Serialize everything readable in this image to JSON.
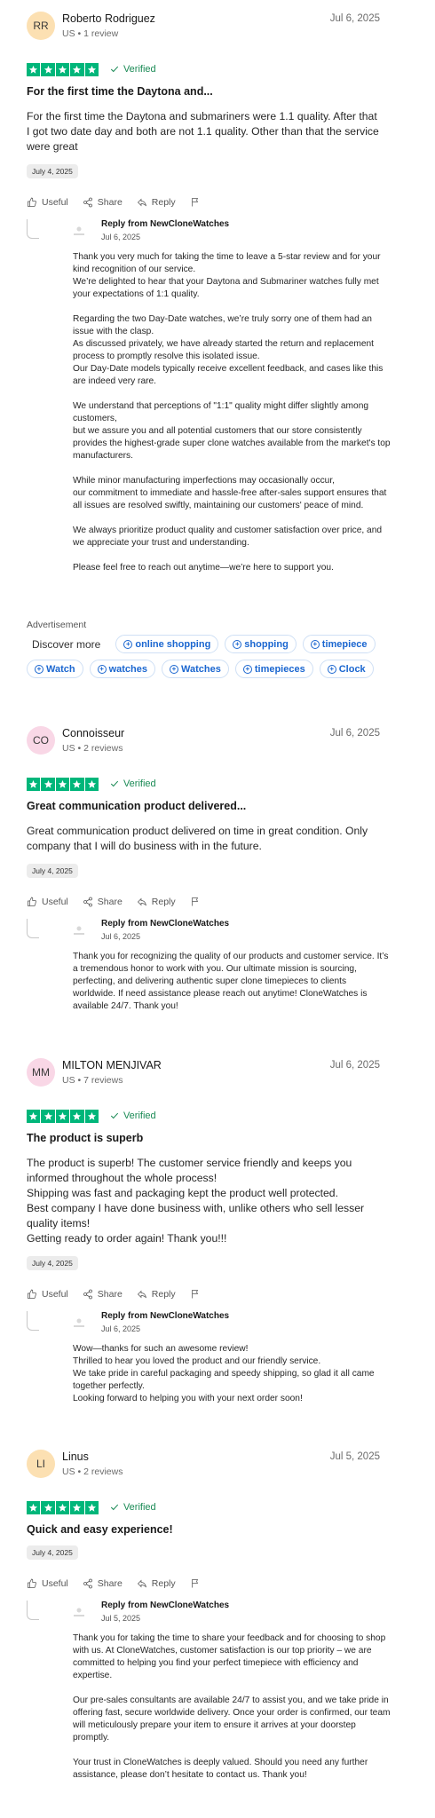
{
  "colors": {
    "star_green": "#00b67a",
    "link_blue": "#1a66d0"
  },
  "icons": {
    "star": "star-icon",
    "verified": "check-icon",
    "useful": "thumbs-up-icon",
    "share": "share-icon",
    "reply": "reply-icon",
    "flag": "flag-icon",
    "chip": "plus-circle-icon"
  },
  "reviews": [
    {
      "initials": "RR",
      "avatar_color": "#fce0b2",
      "author": "Roberto Rodriguez",
      "meta": "US • 1 review",
      "date": "Jul 6, 2025",
      "verified": "Verified",
      "title": "For the first time the Daytona and...",
      "body": "For the first time the Daytona and submariners were 1.1 quality. After that I got two date day and both are not 1.1 quality. Other than that the service were great",
      "experience_date": "July 4, 2025",
      "actions": {
        "useful": "Useful",
        "share": "Share",
        "reply": "Reply"
      },
      "reply": {
        "from": "Reply from NewCloneWatches",
        "date": "Jul 6, 2025",
        "text": "Thank you very much for taking the time to leave a 5-star review and for your kind recognition of our service.\nWe’re delighted to hear that your Daytona and Submariner watches fully met your expectations of 1:1 quality.\n\nRegarding the two Day-Date watches, we’re truly sorry one of them had an issue with the clasp.\nAs discussed privately, we have already started the return and replacement process to promptly resolve this isolated issue.\nOur Day-Date models typically receive excellent feedback, and cases like this are indeed very rare.\n\nWe understand that perceptions of \"1:1\" quality might differ slightly among customers,\nbut we assure you and all potential customers that our store consistently provides the highest-grade super clone watches available from the market's top manufacturers.\n\nWhile minor manufacturing imperfections may occasionally occur,\nour commitment to immediate and hassle-free after-sales support ensures that all issues are resolved swiftly, maintaining our customers' peace of mind.\n\nWe always prioritize product quality and customer satisfaction over price, and we appreciate your trust and understanding.\n\nPlease feel free to reach out anytime—we’re here to support you."
      }
    },
    {
      "initials": "CO",
      "avatar_color": "#f9d7e6",
      "author": "Connoisseur",
      "meta": "US • 2 reviews",
      "date": "Jul 6, 2025",
      "verified": "Verified",
      "title": "Great communication product delivered...",
      "body": "Great communication product delivered on time in great condition. Only company that I will do business with in the future.",
      "experience_date": "July 4, 2025",
      "actions": {
        "useful": "Useful",
        "share": "Share",
        "reply": "Reply"
      },
      "reply": {
        "from": "Reply from NewCloneWatches",
        "date": "Jul 6, 2025",
        "text": "Thank you for recognizing the quality of our products and customer service. It’s a tremendous honor to work with you. Our ultimate mission is sourcing, perfecting, and delivering authentic super clone timepieces to clients worldwide. If need assistance please reach out anytime! CloneWatches is available 24/7. Thank you!"
      }
    },
    {
      "initials": "MM",
      "avatar_color": "#f9d7e6",
      "author": "MILTON MENJIVAR",
      "meta": "US • 7 reviews",
      "date": "Jul 6, 2025",
      "verified": "Verified",
      "title": "The product is superb",
      "body": "The product is superb! The customer service friendly and keeps you informed throughout the whole process!\nShipping was fast and packaging kept the product well protected.\nBest company I have done business with, unlike others who sell lesser quality items!\nGetting ready to order again! Thank you!!!",
      "experience_date": "July 4, 2025",
      "actions": {
        "useful": "Useful",
        "share": "Share",
        "reply": "Reply"
      },
      "reply": {
        "from": "Reply from NewCloneWatches",
        "date": "Jul 6, 2025",
        "text": "Wow—thanks for such an awesome review!\nThrilled to hear you loved the product and our friendly service.\nWe take pride in careful packaging and speedy shipping, so glad it all came together perfectly.\nLooking forward to helping you with your next order soon!"
      }
    },
    {
      "initials": "LI",
      "avatar_color": "#fce0b2",
      "author": "Linus",
      "meta": "US • 2 reviews",
      "date": "Jul 5, 2025",
      "verified": "Verified",
      "title": "Quick and easy experience!",
      "body": "",
      "experience_date": "July 4, 2025",
      "actions": {
        "useful": "Useful",
        "share": "Share",
        "reply": "Reply"
      },
      "reply": {
        "from": "Reply from NewCloneWatches",
        "date": "Jul 5, 2025",
        "text": "Thank you for taking the time to share your feedback and for choosing to shop with us. At CloneWatches, customer satisfaction is our top priority – we are committed to helping you find your perfect timepiece with efficiency and expertise.\n\nOur pre-sales consultants are available 24/7 to assist you, and we take pride in offering fast, secure worldwide delivery. Once your order is confirmed, our team will meticulously prepare your item to ensure it arrives at your doorstep promptly.\n\nYour trust in CloneWatches is deeply valued. Should you need any further assistance, please don’t hesitate to contact us. Thank you!"
      }
    }
  ],
  "ad": {
    "label": "Advertisement",
    "discover": "Discover more",
    "row1": [
      "online shopping",
      "shopping",
      "timepiece"
    ],
    "row2": [
      "Watch",
      "watches",
      "Watches",
      "timepieces",
      "Clock"
    ]
  }
}
